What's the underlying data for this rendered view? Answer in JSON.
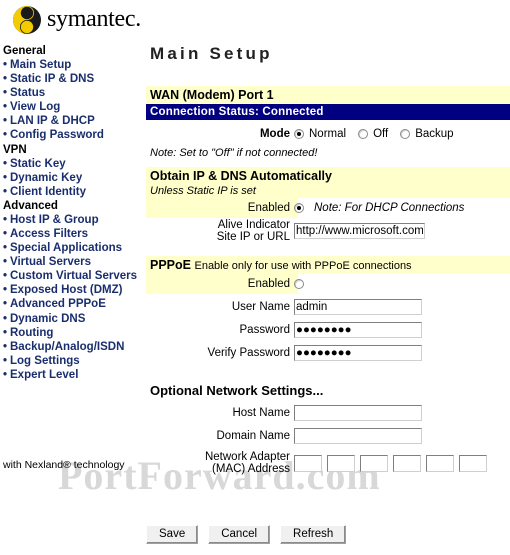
{
  "brand": {
    "name": "symantec.",
    "logo_icon": "symantec-yin-yang-logo",
    "logo_colors": {
      "yellow": "#f2cb00",
      "black": "#1a1a1a"
    }
  },
  "watermark": {
    "text": "PortForward.com"
  },
  "footer": {
    "text": "with Nexland® technology"
  },
  "sidebar": {
    "groups": [
      {
        "title": "General",
        "items": [
          {
            "label": "Main Setup"
          },
          {
            "label": "Static IP & DNS"
          },
          {
            "label": "Status"
          },
          {
            "label": "View Log"
          },
          {
            "label": "LAN IP & DHCP"
          },
          {
            "label": "Config Password"
          }
        ]
      },
      {
        "title": "VPN",
        "items": [
          {
            "label": "Static Key"
          },
          {
            "label": "Dynamic Key"
          },
          {
            "label": "Client Identity"
          }
        ]
      },
      {
        "title": "Advanced",
        "items": [
          {
            "label": "Host IP & Group"
          },
          {
            "label": "Access Filters"
          },
          {
            "label": "Special Applications"
          },
          {
            "label": "Virtual Servers"
          },
          {
            "label": "Custom Virtual Servers"
          },
          {
            "label": "Exposed Host (DMZ)"
          },
          {
            "label": "Advanced PPPoE"
          },
          {
            "label": "Dynamic DNS"
          },
          {
            "label": "Routing"
          },
          {
            "label": "Backup/Analog/ISDN"
          },
          {
            "label": "Log Settings"
          },
          {
            "label": "Expert Level"
          }
        ]
      }
    ]
  },
  "main": {
    "title": "Main Setup",
    "wan": {
      "heading": "WAN (Modem) Port 1",
      "status_bar": "Connection Status: Connected",
      "mode_label": "Mode",
      "modes": [
        {
          "label": "Normal",
          "selected": true
        },
        {
          "label": "Off",
          "selected": false
        },
        {
          "label": "Backup",
          "selected": false
        }
      ],
      "note": "Note: Set to \"Off\" if not connected!"
    },
    "dhcp": {
      "heading": "Obtain IP & DNS Automatically",
      "subheading": "Unless Static IP is set",
      "enabled_label": "Enabled",
      "enabled_selected": true,
      "enabled_note": "Note: For DHCP Connections",
      "alive_label_line1": "Alive Indicator",
      "alive_label_line2": "Site IP or URL",
      "alive_value": "http://www.microsoft.com",
      "alive_placeholder": ""
    },
    "pppoe": {
      "heading": "PPPoE",
      "heading_sub": "Enable only for use with PPPoE connections",
      "enabled_label": "Enabled",
      "enabled_selected": false,
      "fields": [
        {
          "label": "User Name",
          "value": "admin",
          "type": "text"
        },
        {
          "label": "Password",
          "value": "●●●●●●●●",
          "type": "password"
        },
        {
          "label": "Verify Password",
          "value": "●●●●●●●●",
          "type": "password"
        }
      ]
    },
    "optional": {
      "heading": "Optional Network Settings...",
      "fields": [
        {
          "label": "Host Name",
          "value": ""
        },
        {
          "label": "Domain Name",
          "value": ""
        }
      ],
      "mac_label_line1": "Network Adapter",
      "mac_label_line2": "(MAC) Address",
      "mac_octets": [
        "",
        "",
        "",
        "",
        "",
        ""
      ]
    }
  },
  "buttons": [
    {
      "label": "Save"
    },
    {
      "label": "Cancel"
    },
    {
      "label": "Refresh"
    }
  ]
}
